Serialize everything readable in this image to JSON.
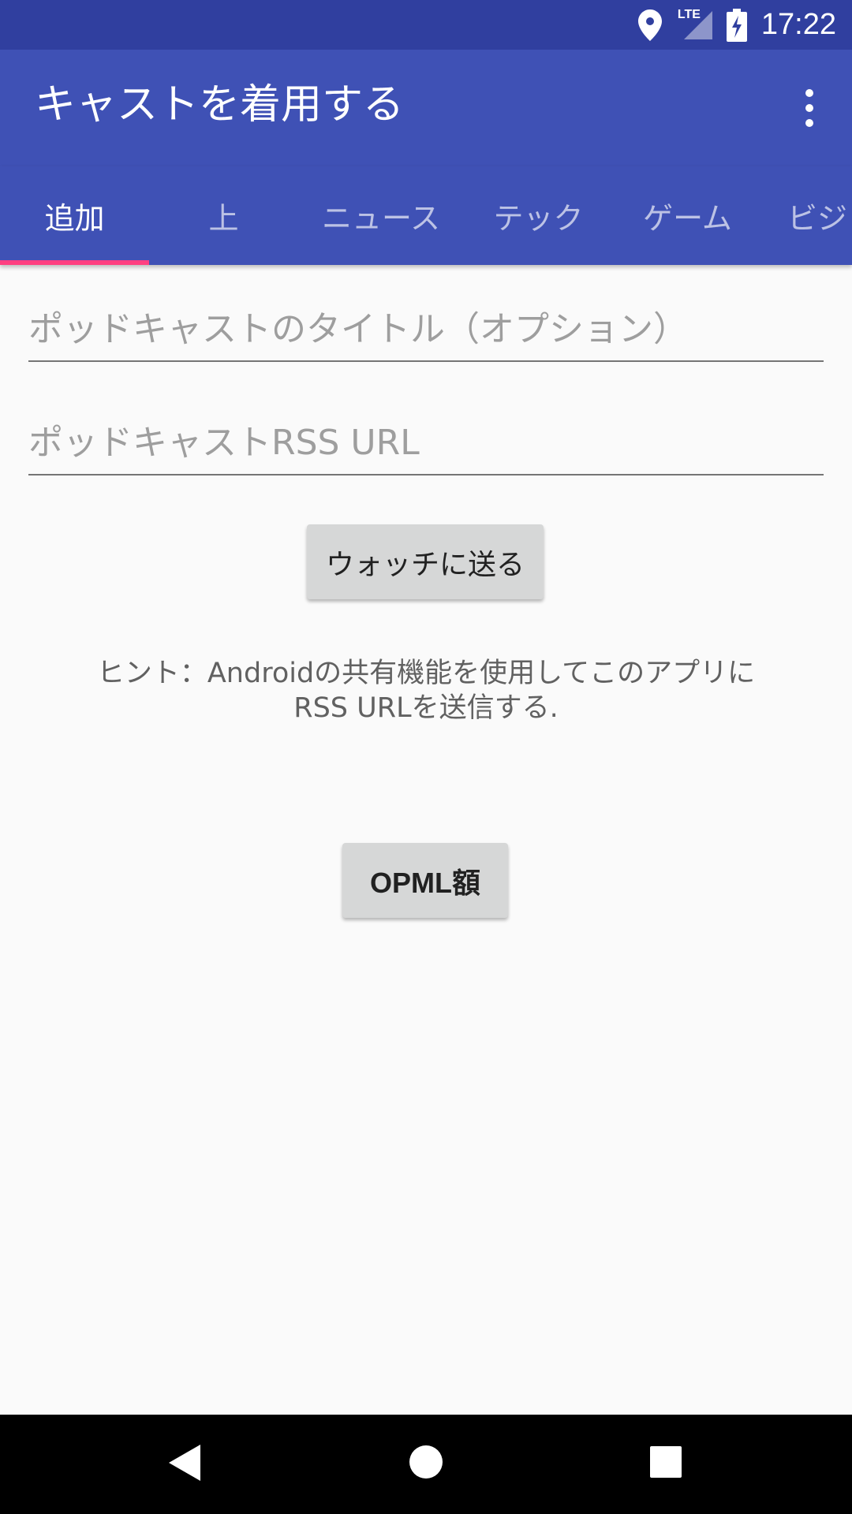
{
  "status_bar": {
    "network": "LTE",
    "time": "17:22"
  },
  "app_bar": {
    "title": "キャストを着用する",
    "menu_icon": "more-vert-icon"
  },
  "tabs": [
    {
      "label": "追加",
      "active": true
    },
    {
      "label": "上",
      "active": false
    },
    {
      "label": "ニュース",
      "active": false
    },
    {
      "label": "テック",
      "active": false
    },
    {
      "label": "ゲーム",
      "active": false
    },
    {
      "label": "ビジ",
      "active": false
    }
  ],
  "form": {
    "title_field": {
      "value": "",
      "placeholder": "ポッドキャストのタイトル（オプション）"
    },
    "url_field": {
      "value": "",
      "placeholder": "ポッドキャストRSS URL"
    },
    "send_button": "ウォッチに送る",
    "hint_line1": "ヒント：Androidの共有機能を使用してこのアプリに",
    "hint_line2": "RSS URLを送信する.",
    "opml_button": "OPML額"
  },
  "colors": {
    "status_bar": "#303f9f",
    "primary": "#3f51b5",
    "accent": "#ff4081",
    "background": "#fafafa",
    "button": "#d6d7d7"
  },
  "nav_bar": {
    "icons": [
      "back-icon",
      "home-icon",
      "recents-icon"
    ]
  }
}
